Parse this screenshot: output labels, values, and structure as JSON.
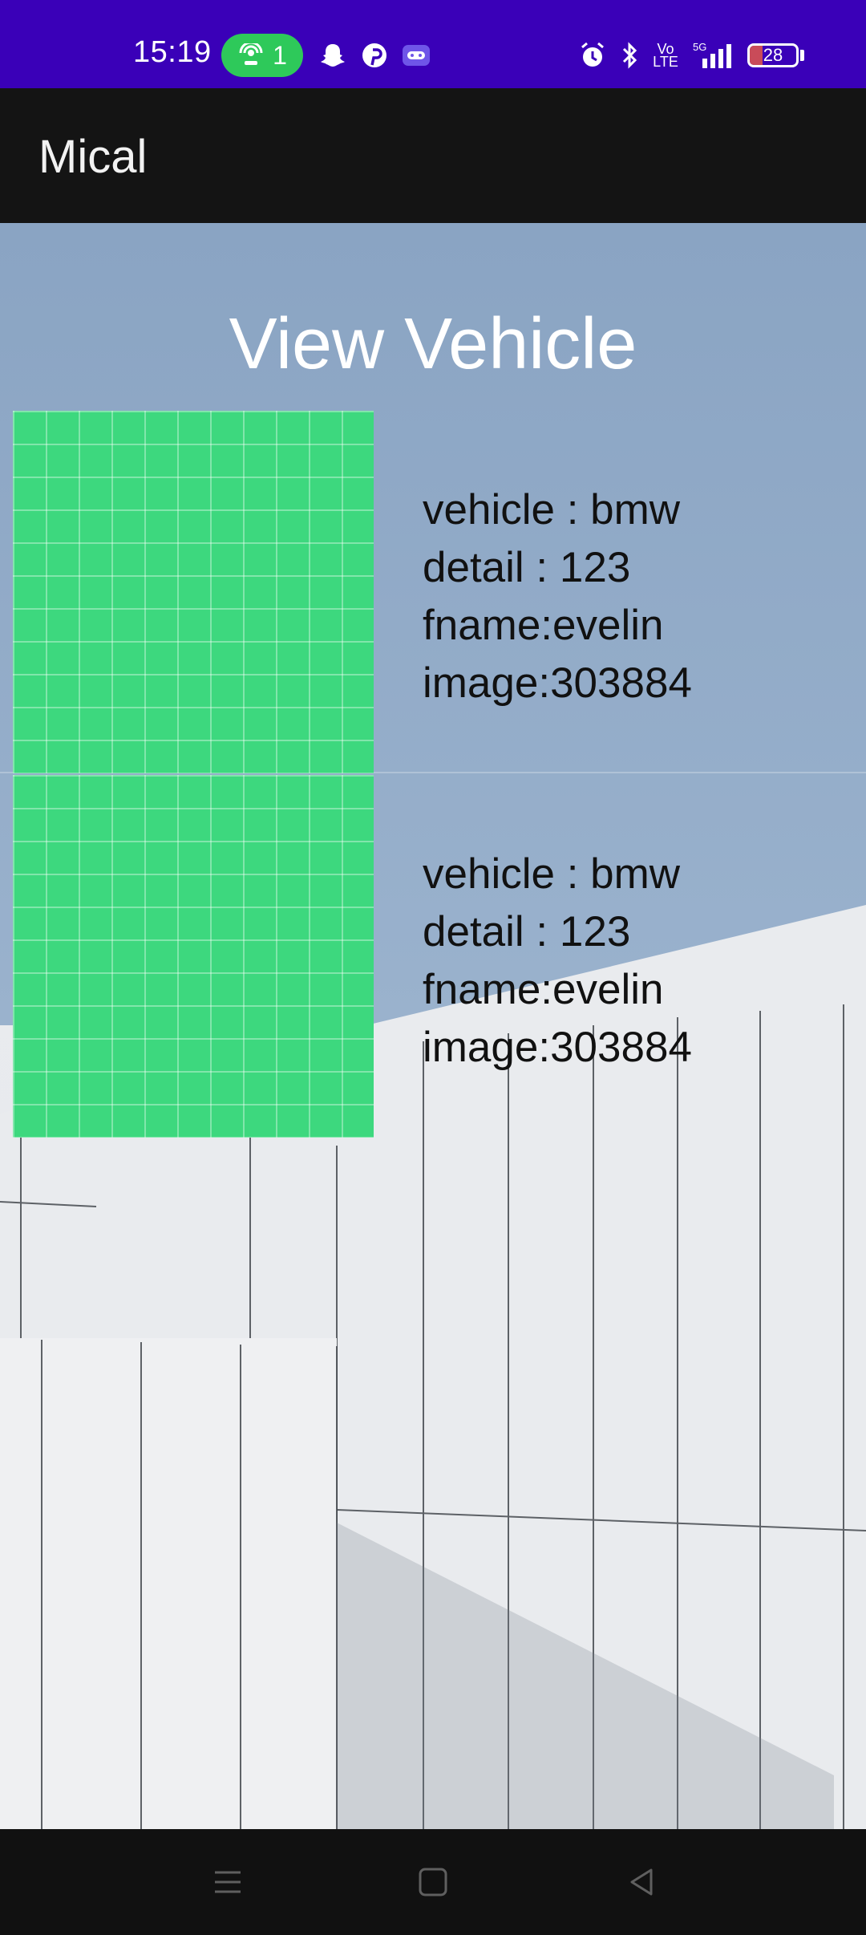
{
  "status_bar": {
    "time": "15:19",
    "hotspot_count": "1",
    "battery": "28",
    "network": "5G",
    "volte": "Vo LTE"
  },
  "app_bar": {
    "title": "Mical"
  },
  "page": {
    "heading": "View Vehicle"
  },
  "vehicles": [
    {
      "vehicle": "vehicle : bmw",
      "detail": "detail : 123",
      "fname": "fname:evelin",
      "image": "image:303884"
    },
    {
      "vehicle": "vehicle : bmw",
      "detail": "detail : 123",
      "fname": "fname:evelin",
      "image": "image:303884"
    }
  ],
  "colors": {
    "status_bar": "#3a00b8",
    "app_bar": "#141414",
    "thumbnail": "#3dd87e",
    "hotspot_pill": "#2ec95a"
  },
  "icons": {
    "status": [
      "hotspot-icon",
      "snapchat-icon",
      "pinterest-icon",
      "game-icon",
      "alarm-icon",
      "bluetooth-icon",
      "signal-icon",
      "battery-icon"
    ],
    "nav": [
      "menu-icon",
      "home-icon",
      "back-icon"
    ]
  }
}
